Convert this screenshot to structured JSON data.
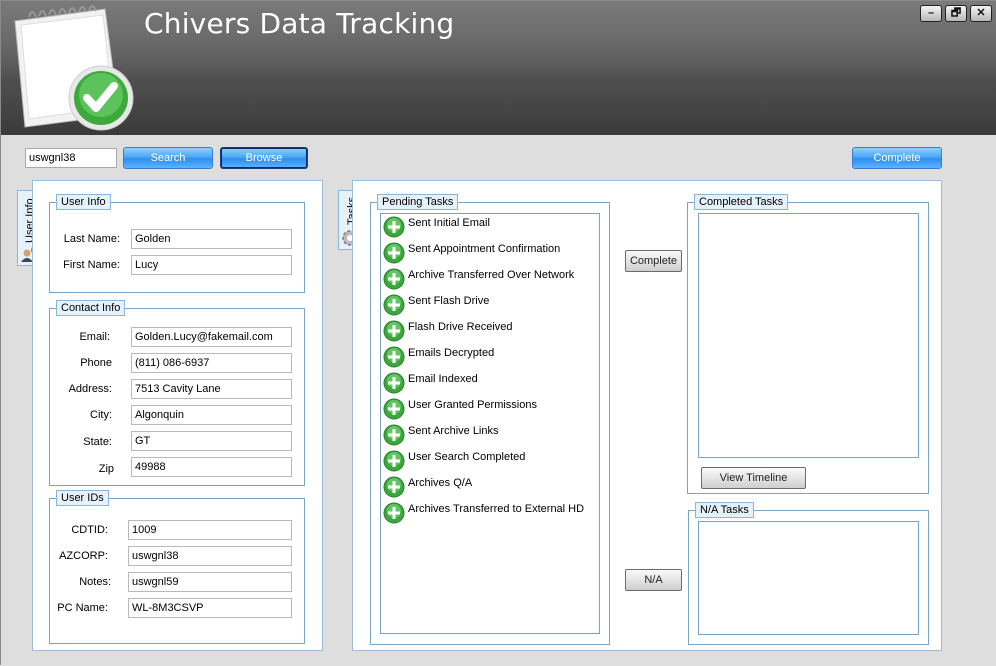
{
  "app": {
    "title": "Chivers Data Tracking"
  },
  "window_controls": {
    "minimize": "–",
    "restore": "🗗",
    "close": "✕"
  },
  "toolbar": {
    "search_value": "uswgnl38",
    "search_label": "Search",
    "browse_label": "Browse",
    "complete_label": "Complete"
  },
  "user_info_tab": {
    "label": "User Info"
  },
  "user_info": {
    "title": "User Info",
    "last_name_label": "Last Name:",
    "last_name": "Golden",
    "first_name_label": "First Name:",
    "first_name": "Lucy"
  },
  "contact_info": {
    "title": "Contact Info",
    "email_label": "Email:",
    "email": "Golden.Lucy@fakemail.com",
    "phone_label": "Phone",
    "phone": "(811) 086-6937",
    "address_label": "Address:",
    "address": "7513 Cavity Lane",
    "city_label": "City:",
    "city": "Algonquin",
    "state_label": "State:",
    "state": "GT",
    "zip_label": "Zip",
    "zip": "49988"
  },
  "user_ids": {
    "title": "User IDs",
    "cdtid_label": "CDTID:",
    "cdtid": "1009",
    "azcorp_label": "AZCORP:",
    "azcorp": "uswgnl38",
    "notes_label": "Notes:",
    "notes": "uswgnl59",
    "pc_name_label": "PC Name:",
    "pc_name": "WL-8M3CSVP"
  },
  "tasks_tab": {
    "label": "Tasks"
  },
  "pending_tasks": {
    "title": "Pending Tasks",
    "items": [
      "Sent Initial Email",
      "Sent Appointment Confirmation",
      "Archive Transferred Over Network",
      "Sent Flash Drive",
      "Flash Drive Received",
      "Emails Decrypted",
      "Email Indexed",
      "User Granted Permissions",
      "Sent Archive Links",
      "User Search Completed",
      "Archives Q/A",
      "Archives Transferred to External HD"
    ]
  },
  "task_actions": {
    "complete_label": "Complete",
    "na_label": "N/A"
  },
  "completed_tasks": {
    "title": "Completed Tasks",
    "view_timeline_label": "View Timeline"
  },
  "na_tasks": {
    "title": "N/A Tasks"
  },
  "colors": {
    "accent_blue": "#2f8ef0",
    "group_border": "#7aa3c8",
    "plus_green": "#3aa83a"
  }
}
